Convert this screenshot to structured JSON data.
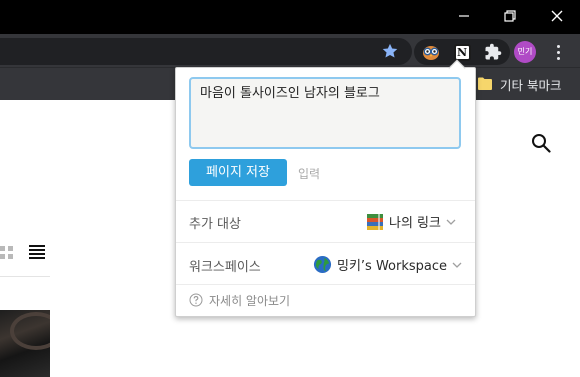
{
  "window": {
    "controls": [
      "minimize-icon",
      "maximize-icon",
      "close-icon"
    ]
  },
  "toolbar": {
    "bookmark_star_icon": "star-icon",
    "extensions": [
      "owl-extension-icon",
      "notion-extension-icon",
      "puzzle-icon"
    ],
    "notion_glyph": "N",
    "profile_label": "민기",
    "profile_color": "#b04bc6",
    "menu_icon": "three-dots-icon"
  },
  "bookmarks": {
    "other_label": "기타 북마크"
  },
  "clipper": {
    "title_value": "마음이 톨사이즈인 남자의 블로그",
    "save_button": "페이지 저장",
    "input_link": "입력",
    "add_to": {
      "label": "추가 대상",
      "value": "나의 링크",
      "icon": "books-icon"
    },
    "workspace": {
      "label": "워크스페이스",
      "value": "밍키’s Workspace",
      "icon": "globe-icon"
    },
    "help": {
      "label": "자세히 알아보기",
      "icon": "question-icon"
    },
    "accent": "#2ea0dc"
  },
  "page": {
    "icons": [
      "search-icon",
      "grid-view-icon",
      "list-view-icon"
    ]
  }
}
